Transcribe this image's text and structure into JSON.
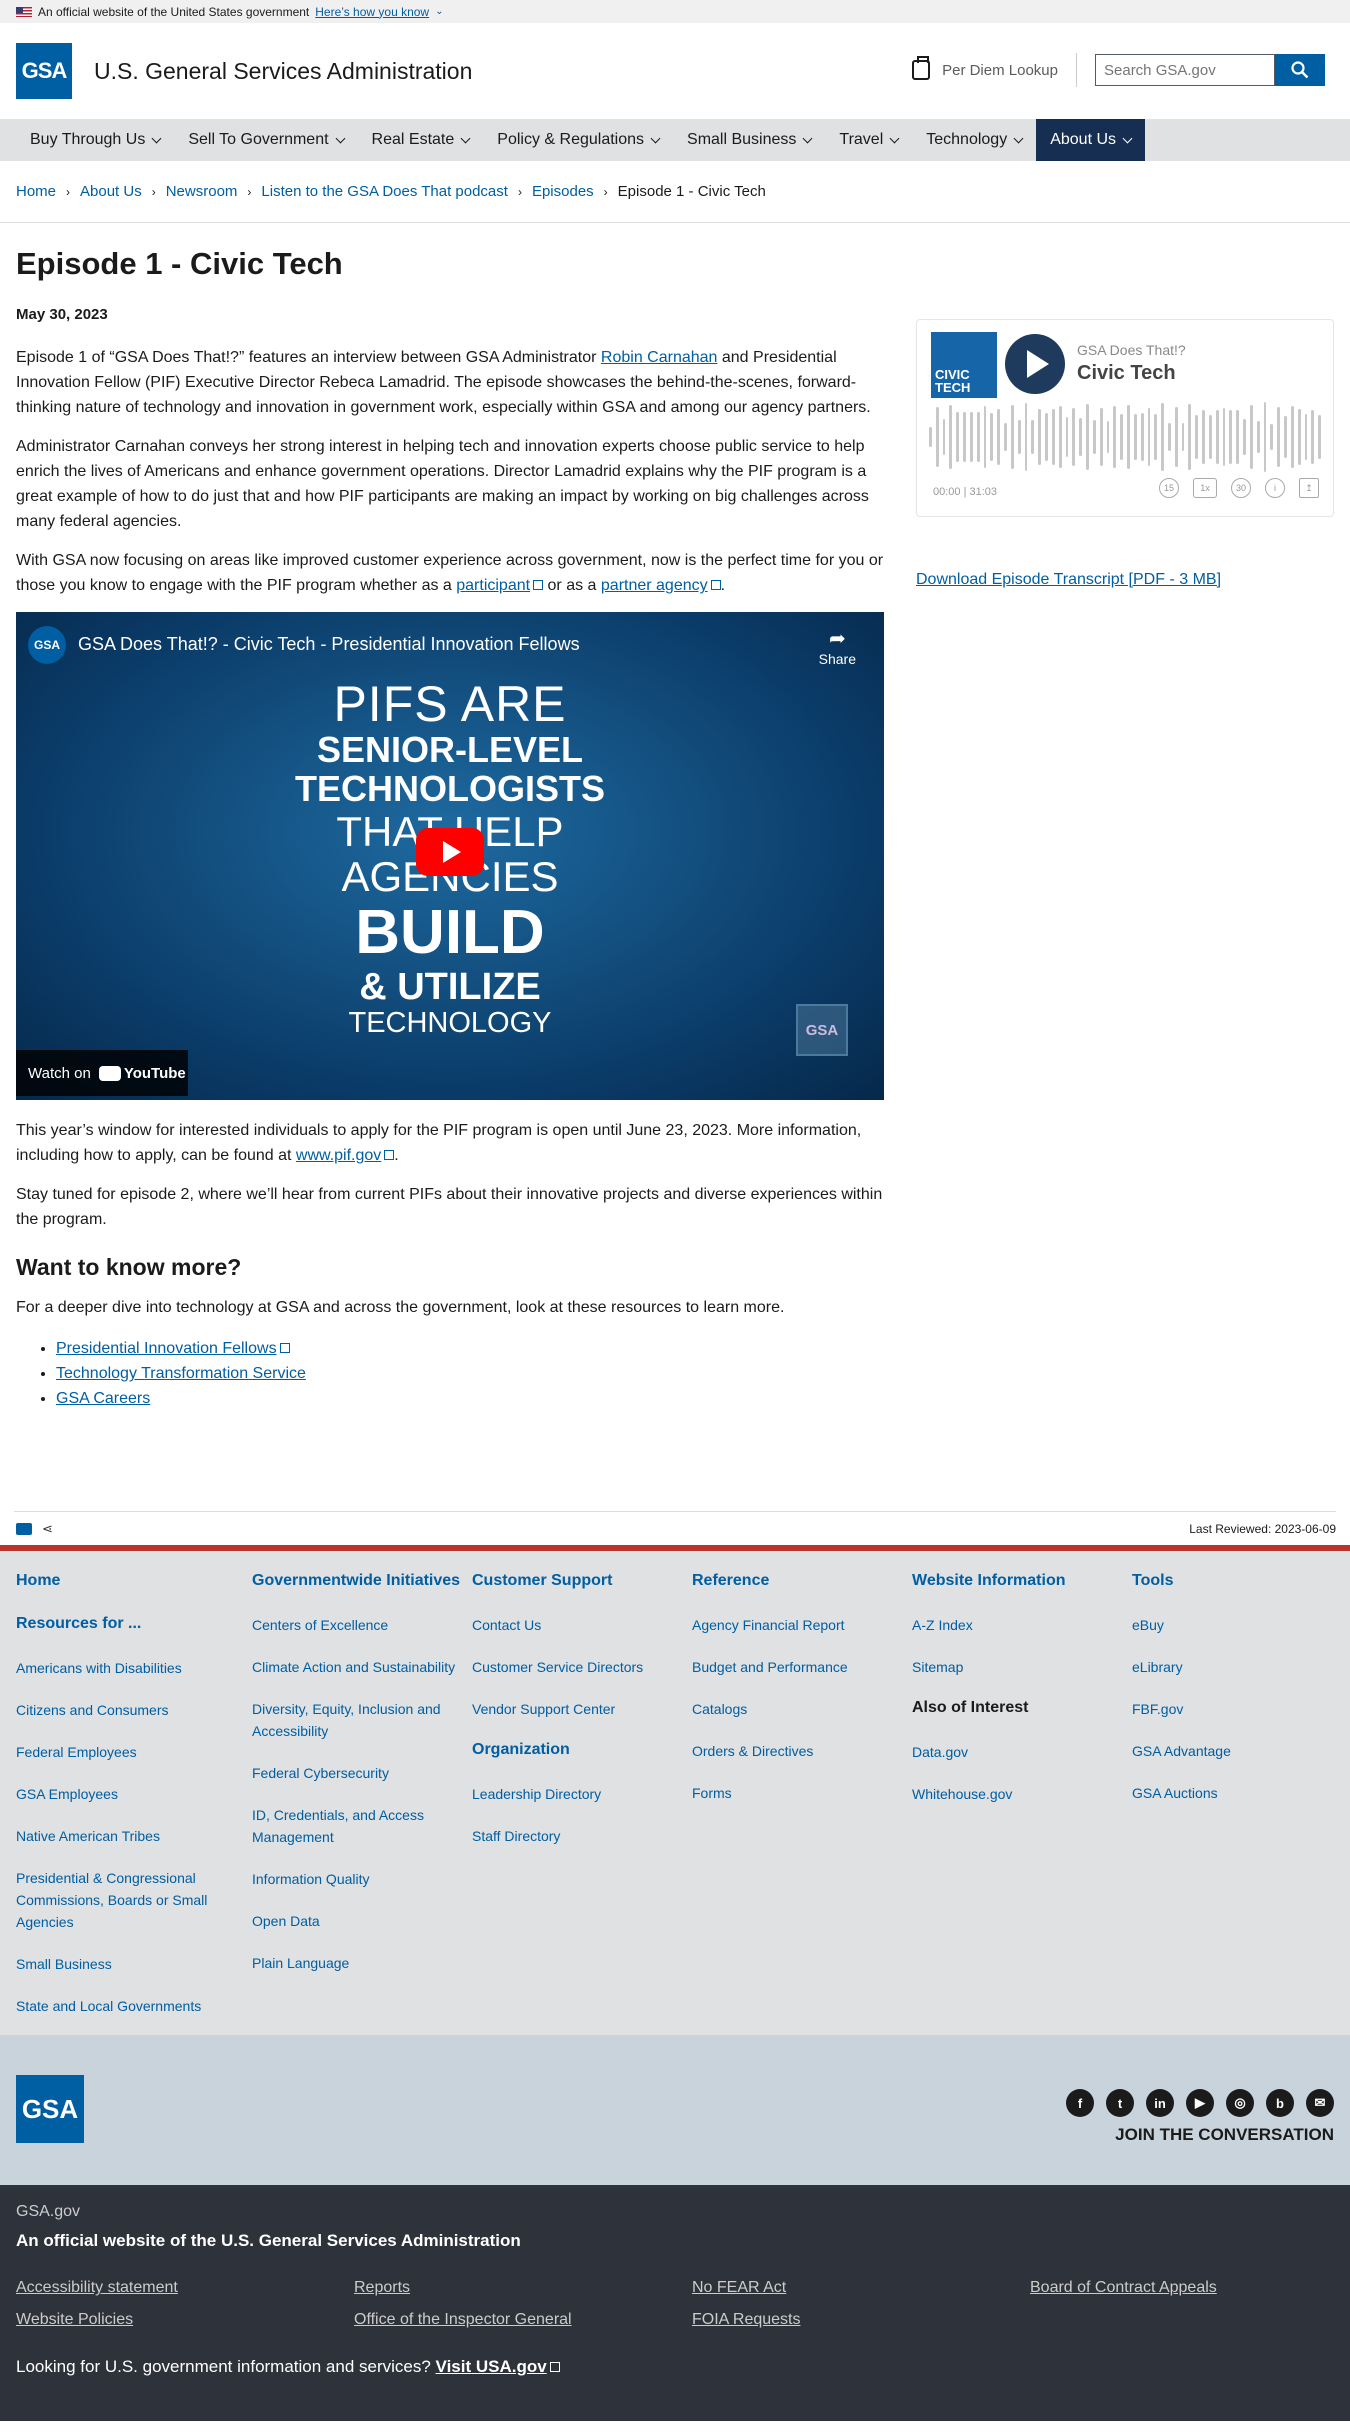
{
  "banner": {
    "text": "An official website of the United States government",
    "link": "Here’s how you know"
  },
  "header": {
    "logo": "GSA",
    "title": "U.S. General Services Administration",
    "per_diem": "Per Diem Lookup",
    "search_placeholder": "Search GSA.gov"
  },
  "nav": [
    "Buy Through Us",
    "Sell To Government",
    "Real Estate",
    "Policy & Regulations",
    "Small Business",
    "Travel",
    "Technology",
    "About Us"
  ],
  "breadcrumbs": [
    "Home",
    "About Us",
    "Newsroom",
    "Listen to the GSA Does That podcast",
    "Episodes",
    "Episode 1 - Civic Tech"
  ],
  "article": {
    "title": "Episode 1 - Civic Tech",
    "date": "May 30, 2023",
    "p1a": "Episode 1 of “GSA Does That!?” features an interview between GSA Administrator ",
    "p1link": "Robin Carnahan",
    "p1b": " and Presidential Innovation Fellow (PIF) Executive Director Rebeca Lamadrid. The episode showcases the behind-the-scenes, forward-thinking nature of technology and innovation in government work, especially within GSA and among our agency partners.",
    "p2": "Administrator Carnahan conveys her strong interest in helping tech and innovation experts choose public service to help enrich the lives of Americans and enhance government operations. Director Lamadrid explains why the PIF program is a great example of how to do just that and how PIF participants are making an impact by working on big challenges across many federal agencies.",
    "p3a": "With GSA now focusing on areas like improved customer experience across government, now is the perfect time for you or those you know to engage with the PIF program whether as a ",
    "p3link1": "participant",
    "p3b": " or as a ",
    "p3link2": "partner agency",
    "p3c": ".",
    "video": {
      "title": "GSA Does That!? - Civic Tech - Presidential Innovation Fellows",
      "logo": "GSA",
      "share": "Share",
      "lines": [
        "PIFS ARE",
        "SENIOR-LEVEL",
        "TECHNOLOGISTS",
        "THAT HELP",
        "AGENCIES",
        "BUILD",
        "& UTILIZE",
        "TECHNOLOGY"
      ],
      "watch": "Watch on",
      "yt": "YouTube",
      "watermark": "GSA"
    },
    "p4a": "This year’s window for interested individuals to apply for the PIF program is open until June 23, 2023. More information, including how to apply, can be found at ",
    "p4link": "www.pif.gov",
    "p4b": ".",
    "p5": "Stay tuned for episode 2, where we’ll hear from current PIFs about their innovative projects and diverse experiences within the program.",
    "h2": "Want to know more?",
    "p6": "For a deeper dive into technology at GSA and across the government, look at these resources to learn more.",
    "resources": [
      "Presidential Innovation Fellows",
      "Technology Transformation Service",
      "GSA Careers"
    ]
  },
  "player": {
    "cover": "CIVIC TECH",
    "show": "GSA Does That!?",
    "episode": "Civic Tech",
    "time": "00:00  |  31:03",
    "controls": [
      "15",
      "1x",
      "30",
      "i",
      "↥"
    ]
  },
  "transcript": "Download Episode Transcript [PDF - 3 MB]",
  "last_reviewed": "Last Reviewed: 2023-06-09",
  "footer": {
    "home": "Home",
    "resources_title": "Resources for ...",
    "resources": [
      "Americans with Disabilities",
      "Citizens and Consumers",
      "Federal Employees",
      "GSA Employees",
      "Native American Tribes",
      "Presidential & Congressional Commissions, Boards or Small Agencies",
      "Small Business",
      "State and Local Governments"
    ],
    "gov_title": "Governmentwide Initiatives",
    "gov": [
      "Centers of Excellence",
      "Climate Action and Sustainability",
      "Diversity, Equity, Inclusion and Accessibility",
      "Federal Cybersecurity",
      "ID, Credentials, and Access Management",
      "Information Quality",
      "Open Data",
      "Plain Language"
    ],
    "cs_title": "Customer Support",
    "cs": [
      "Contact Us",
      "Customer Service Directors",
      "Vendor Support Center"
    ],
    "org_title": "Organization",
    "org": [
      "Leadership Directory",
      "Staff Directory"
    ],
    "ref_title": "Reference",
    "ref": [
      "Agency Financial Report",
      "Budget and Performance",
      "Catalogs",
      "Orders & Directives",
      "Forms"
    ],
    "wi_title": "Website Information",
    "wi": [
      "A-Z Index",
      "Sitemap"
    ],
    "aoi_title": "Also of Interest",
    "aoi": [
      "Data.gov",
      "Whitehouse.gov"
    ],
    "tools_title": "Tools",
    "tools": [
      "eBuy",
      "eLibrary",
      "FBF.gov",
      "GSA Advantage",
      "GSA Auctions"
    ],
    "logo": "GSA",
    "social": [
      "f",
      "t",
      "in",
      "▶",
      "◎",
      "b",
      "✉"
    ],
    "join": "JOIN THE CONVERSATION"
  },
  "identifier": {
    "domain": "GSA.gov",
    "official": "An official website of the U.S. General Services Administration",
    "links": [
      "Accessibility statement",
      "Reports",
      "No FEAR Act",
      "Board of Contract Appeals",
      "Website Policies",
      "Office of the Inspector General",
      "FOIA Requests"
    ],
    "usa_text": "Looking for U.S. government information and services? ",
    "usa_link": "Visit USA.gov"
  }
}
